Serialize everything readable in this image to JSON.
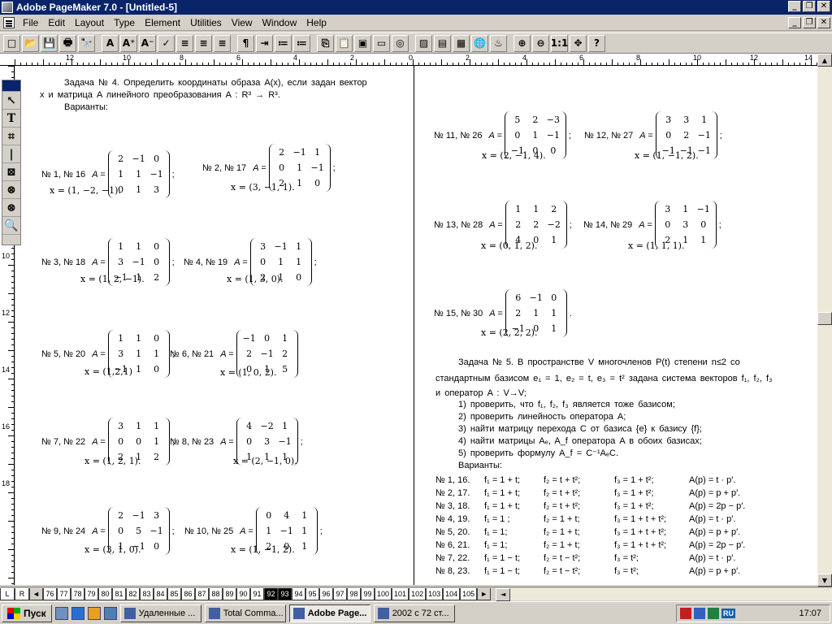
{
  "window": {
    "title": "Adobe PageMaker 7.0 - [Untitled-5]"
  },
  "menu": [
    "File",
    "Edit",
    "Layout",
    "Type",
    "Element",
    "Utilities",
    "View",
    "Window",
    "Help"
  ],
  "ruler_h": [
    "12",
    "10",
    "8",
    "6",
    "4",
    "2",
    "0",
    "2",
    "4",
    "6",
    "8",
    "10",
    "12",
    "14"
  ],
  "ruler_v": [
    "8",
    "10",
    "12",
    "14",
    "16",
    "18"
  ],
  "toolbox": [
    {
      "icon": "pointer-icon",
      "glyph": "↖"
    },
    {
      "icon": "text-tool-icon",
      "glyph": "T"
    },
    {
      "icon": "crop-tool-icon",
      "glyph": "⌗"
    },
    {
      "icon": "line-tool-icon",
      "glyph": "|"
    },
    {
      "icon": "frame-tool-icon",
      "glyph": "⊠"
    },
    {
      "icon": "ellipse-frame-icon",
      "glyph": "⊗"
    },
    {
      "icon": "polygon-frame-icon",
      "glyph": "⊗"
    },
    {
      "icon": "zoom-tool-icon",
      "glyph": "🔍"
    }
  ],
  "toolbar": [
    {
      "icon": "new-icon",
      "glyph": "□"
    },
    {
      "icon": "open-icon",
      "glyph": "📂"
    },
    {
      "icon": "save-icon",
      "glyph": "💾"
    },
    {
      "icon": "print-icon",
      "glyph": "🖶"
    },
    {
      "icon": "find-icon",
      "glyph": "🔭"
    },
    {
      "icon": "text-icon",
      "glyph": "A"
    },
    {
      "icon": "font-larger-icon",
      "glyph": "A⁺"
    },
    {
      "icon": "font-smaller-icon",
      "glyph": "A⁻"
    },
    {
      "icon": "spellcheck-icon",
      "glyph": "✓"
    },
    {
      "icon": "style-icon",
      "glyph": "≡"
    },
    {
      "icon": "align-left-icon",
      "glyph": "≡"
    },
    {
      "icon": "align-right-icon",
      "glyph": "≡"
    },
    {
      "icon": "paragraph-icon",
      "glyph": "¶"
    },
    {
      "icon": "indents-icon",
      "glyph": "⇥"
    },
    {
      "icon": "bullets-icon",
      "glyph": "≔"
    },
    {
      "icon": "numbering-icon",
      "glyph": "≔"
    },
    {
      "icon": "copy-icon",
      "glyph": "⎘"
    },
    {
      "icon": "paste-icon",
      "glyph": "📋"
    },
    {
      "icon": "place-icon",
      "glyph": "▣"
    },
    {
      "icon": "frame-icon",
      "glyph": "▭"
    },
    {
      "icon": "link-icon",
      "glyph": "◎"
    },
    {
      "icon": "image-icon",
      "glyph": "▨"
    },
    {
      "icon": "export-icon",
      "glyph": "▤"
    },
    {
      "icon": "photo-icon",
      "glyph": "▦"
    },
    {
      "icon": "globe-icon",
      "glyph": "🌐"
    },
    {
      "icon": "pdf-icon",
      "glyph": "♨"
    },
    {
      "icon": "zoom-in-icon",
      "glyph": "⊕"
    },
    {
      "icon": "zoom-out-icon",
      "glyph": "⊖"
    },
    {
      "icon": "actual-size-icon",
      "glyph": "1:1"
    },
    {
      "icon": "fit-window-icon",
      "glyph": "✥"
    },
    {
      "icon": "help-icon",
      "glyph": "?"
    }
  ],
  "doc": {
    "z4_line1": "Задача № 4. Определить координаты образа A(x), если задан вектор",
    "z4_line2": "x и матрица A линейного преобразования A : R³ → R³.",
    "z4_line3": "Варианты:",
    "variants": [
      {
        "label": "№ 1, № 16",
        "matrix": [
          [
            "2",
            "−1",
            "0"
          ],
          [
            "1",
            "1",
            "−1"
          ],
          [
            "0",
            "1",
            "3"
          ]
        ],
        "sep": ";",
        "x": "x = (1,  −2,  −1)."
      },
      {
        "label": "№ 2, № 17",
        "matrix": [
          [
            "2",
            "−1",
            "1"
          ],
          [
            "0",
            "1",
            "−1"
          ],
          [
            "2",
            "1",
            "0"
          ]
        ],
        "sep": ";",
        "x": "x = (3,  −1,  1)."
      },
      {
        "label": "№ 3, № 18",
        "matrix": [
          [
            "1",
            "1",
            "0"
          ],
          [
            "3",
            "−1",
            "0"
          ],
          [
            "−1",
            "1",
            "2"
          ]
        ],
        "sep": ";",
        "x": "x = (1,  2,  −1)."
      },
      {
        "label": "№ 4, № 19",
        "matrix": [
          [
            "3",
            "−1",
            "1"
          ],
          [
            "0",
            "1",
            "1"
          ],
          [
            "2",
            "1",
            "0"
          ]
        ],
        "sep": ";",
        "x": "x = (1,  3,  0)."
      },
      {
        "label": "№ 5, № 20",
        "matrix": [
          [
            "1",
            "1",
            "0"
          ],
          [
            "3",
            "1",
            "1"
          ],
          [
            "−1",
            "1",
            "0"
          ]
        ],
        "sep": ";",
        "x": "x = (1,2,1)"
      },
      {
        "label": "№ 6, № 21",
        "matrix": [
          [
            "−1",
            "0",
            "1"
          ],
          [
            "2",
            "−1",
            "2"
          ],
          [
            "0",
            "1",
            "5"
          ]
        ],
        "sep": "",
        "x": "x = (1,  0,  2)."
      },
      {
        "label": "№ 7, № 22",
        "matrix": [
          [
            "3",
            "1",
            "1"
          ],
          [
            "0",
            "0",
            "1"
          ],
          [
            "2",
            "1",
            "2"
          ]
        ],
        "sep": ";",
        "x": "x = (1,  2,  1)."
      },
      {
        "label": "№ 8, № 23",
        "matrix": [
          [
            "4",
            "−2",
            "1"
          ],
          [
            "0",
            "3",
            "−1"
          ],
          [
            "1",
            "1",
            "1"
          ]
        ],
        "sep": ";",
        "x": "x = (2,  −1,  0)."
      },
      {
        "label": "№ 9, № 24",
        "matrix": [
          [
            "2",
            "−1",
            "3"
          ],
          [
            "0",
            "5",
            "−1"
          ],
          [
            "1",
            "−1",
            "0"
          ]
        ],
        "sep": ";",
        "x": "x = (3,  1,  0)."
      },
      {
        "label": "№ 10, № 25",
        "matrix": [
          [
            "0",
            "4",
            "1"
          ],
          [
            "1",
            "−1",
            "1"
          ],
          [
            "2",
            "0",
            "1"
          ]
        ],
        "sep": ";",
        "x": "x = (1,  −1,  2)."
      },
      {
        "label": "№ 11, № 26",
        "matrix": [
          [
            "5",
            "2",
            "−3"
          ],
          [
            "0",
            "1",
            "−1"
          ],
          [
            "−1",
            "0",
            "0"
          ]
        ],
        "sep": ";",
        "x": "x = (2,  −1,  4)."
      },
      {
        "label": "№ 12, № 27",
        "matrix": [
          [
            "3",
            "3",
            "1"
          ],
          [
            "0",
            "2",
            "−1"
          ],
          [
            "−1",
            "−1",
            "−1"
          ]
        ],
        "sep": ";",
        "x": "x = (1,  −1,  2)."
      },
      {
        "label": "№ 13, № 28",
        "matrix": [
          [
            "1",
            "1",
            "2"
          ],
          [
            "2",
            "2",
            "−2"
          ],
          [
            "4",
            "0",
            "1"
          ]
        ],
        "sep": ";",
        "x": "x = (0,  1,  2)."
      },
      {
        "label": "№ 14, № 29",
        "matrix": [
          [
            "3",
            "1",
            "−1"
          ],
          [
            "0",
            "3",
            "0"
          ],
          [
            "2",
            "1",
            "1"
          ]
        ],
        "sep": ";",
        "x": "x = (1,  1,  1)."
      },
      {
        "label": "№ 15, № 30",
        "matrix": [
          [
            "6",
            "−1",
            "0"
          ],
          [
            "2",
            "1",
            "1"
          ],
          [
            "−1",
            "0",
            "1"
          ]
        ],
        "sep": ".",
        "x": "x = (2,  2,  2)."
      }
    ],
    "z5_line1": "Задача № 5. В пространстве V многочленов P(t) степени n≤2 со",
    "z5_line2": "стандартным базисом e₁ = 1, e₂ = t, e₃ = t² задана система векторов f₁, f₂, f₃",
    "z5_line3": "и оператор A : V→V;",
    "z5_items": [
      "1) проверить, что f₁, f₂, f₃ является тоже базисом;",
      "2) проверить линейность оператора A;",
      "3) найти матрицу перехода C от базиса {e} к базису {f};",
      "4) найти матрицы Aₑ, A_f оператора A в обоих базисах;",
      "5) проверить формулу A_f = C⁻¹AₑC."
    ],
    "z5_variants_label": "Варианты:",
    "z5_rows": [
      [
        "№ 1, 16.",
        "f₁ = 1 + t;",
        "f₂ = t + t²;",
        "f₃ = 1 + t²;",
        "A(p) = t · p′."
      ],
      [
        "№ 2, 17.",
        "f₁ = 1 + t;",
        "f₂ = t + t²;",
        "f₃ = 1 + t²;",
        "A(p) = p + p′."
      ],
      [
        "№ 3, 18.",
        "f₁ = 1 + t;",
        "f₂ = t + t²;",
        "f₃ = 1 + t²;",
        "A(p) = 2p − p′."
      ],
      [
        "№ 4, 19.",
        "f₁ = 1 ;",
        "f₂ = 1 + t;",
        "f₃ = 1 + t + t²;",
        "A(p) = t · p′."
      ],
      [
        "№ 5, 20.",
        "f₁ = 1;",
        "f₂ = 1 + t;",
        "f₃ = 1 + t + t²;",
        "A(p) = p + p′."
      ],
      [
        "№ 6, 21.",
        "f₁ = 1;",
        "f₂ = 1 + t;",
        "f₃ = 1 + t + t²;",
        "A(p) = 2p − p′."
      ],
      [
        "№ 7, 22.",
        "f₁ = 1 − t;",
        "f₂ = t − t²;",
        "f₃ = t²;",
        "A(p) = t · p′."
      ],
      [
        "№ 8, 23.",
        "f₁ = 1 − t;",
        "f₂ = t − t²;",
        "f₃ = t²;",
        "A(p) = p + p′."
      ]
    ]
  },
  "pagetabs": [
    "L",
    "R",
    "76",
    "77",
    "78",
    "79",
    "80",
    "81",
    "82",
    "83",
    "84",
    "85",
    "86",
    "87",
    "88",
    "89",
    "90",
    "91",
    "92",
    "93",
    "94",
    "95",
    "96",
    "97",
    "98",
    "99",
    "100",
    "101",
    "102",
    "103",
    "104",
    "105"
  ],
  "pagetabs_selected": [
    "92",
    "93"
  ],
  "taskbar": {
    "start": "Пуск",
    "tasks": [
      {
        "label": "Удаленные ...",
        "active": false
      },
      {
        "label": "Total Comma...",
        "active": false
      },
      {
        "label": "Adobe Page...",
        "active": true
      },
      {
        "label": "2002 с 72 ст...",
        "active": false
      }
    ],
    "lang": "RU",
    "clock": "17:07"
  }
}
